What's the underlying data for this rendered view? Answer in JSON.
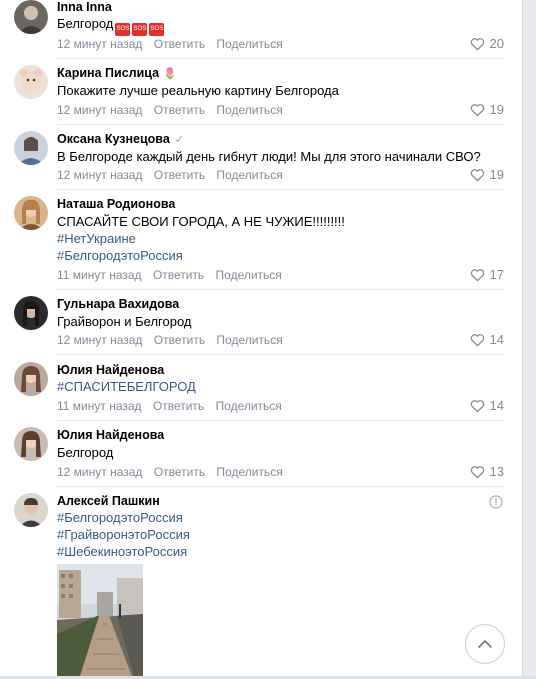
{
  "comments": [
    {
      "author": "Inna Inna",
      "text": [
        "Белгород"
      ],
      "badges": [
        "SOS",
        "SOS",
        "SOS"
      ],
      "time": "12 минут назад",
      "reply": "Ответить",
      "share": "Поделиться",
      "likes": "20"
    },
    {
      "author": "Карина Пислица",
      "author_deco": "🌷",
      "text": [
        "Покажите лучше реальную картину Белгорода"
      ],
      "time": "12 минут назад",
      "reply": "Ответить",
      "share": "Поделиться",
      "likes": "19"
    },
    {
      "author": "Оксана Кузнецова",
      "verified": "✓",
      "text": [
        "В Белгороде каждый день гибнут люди! Мы для этого начинали СВО?"
      ],
      "time": "12 минут назад",
      "reply": "Ответить",
      "share": "Поделиться",
      "likes": "19"
    },
    {
      "author": "Наташа Родионова",
      "text": [
        "СПАСАЙТЕ СВОИ ГОРОДА, А НЕ ЧУЖИЕ!!!!!!!!!",
        "#НетУкраине",
        "#БелгородэтоРоссия"
      ],
      "time": "11 минут назад",
      "reply": "Ответить",
      "share": "Поделиться",
      "likes": "17"
    },
    {
      "author": "Гульнара Вахидова",
      "text": [
        "Грайворон и Белгород"
      ],
      "time": "12 минут назад",
      "reply": "Ответить",
      "share": "Поделиться",
      "likes": "14"
    },
    {
      "author": "Юлия Найденова",
      "text": [
        "#СПАСИТЕБЕЛГОРОД"
      ],
      "time": "11 минут назад",
      "reply": "Ответить",
      "share": "Поделиться",
      "likes": "14"
    },
    {
      "author": "Юлия Найденова",
      "text": [
        "Белгород"
      ],
      "time": "12 минут назад",
      "reply": "Ответить",
      "share": "Поделиться",
      "likes": "13"
    },
    {
      "author": "Алексей Пашкин",
      "text": [
        "#БелгородэтоРоссия",
        "#ГрайворонэтоРоссия",
        "#ШебекиноэтоРоссия"
      ]
    }
  ],
  "icons": {
    "like": "heart-icon",
    "report": "info-icon",
    "scroll_top": "chevron-up-icon"
  },
  "colors": {
    "link": "#3a5a82",
    "muted": "#818c99",
    "sos": "#e0302a"
  }
}
